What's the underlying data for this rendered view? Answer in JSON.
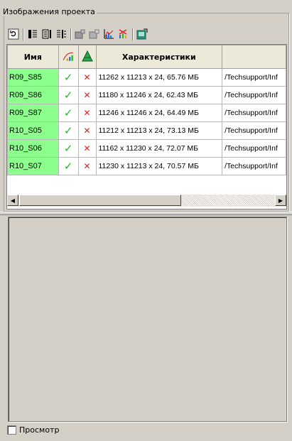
{
  "group": {
    "title": "Изображения проекта"
  },
  "toolbar": {
    "buttons": [
      "refresh-icon",
      "columns-left-icon",
      "columns-center-icon",
      "columns-right-icon",
      "image-add-icon",
      "image-remove-icon",
      "histogram-icon",
      "histogram-remove-icon",
      "export-icon"
    ]
  },
  "table": {
    "headers": {
      "name": "Имя",
      "characteristics": "Характеристики"
    },
    "rows": [
      {
        "name": "R09_S85",
        "characteristics": "11262 x 11213 x 24, 65.76 МБ",
        "path": "/Techsupport/Inf"
      },
      {
        "name": "R09_S86",
        "characteristics": "11180 x 11246 x 24, 62.43 МБ",
        "path": "/Techsupport/Inf"
      },
      {
        "name": "R09_S87",
        "characteristics": "11246 x 11246 x 24, 64.49 МБ",
        "path": "/Techsupport/Inf"
      },
      {
        "name": "R10_S05",
        "characteristics": "11212 x 11213 x 24, 73.13 МБ",
        "path": "/Techsupport/Inf"
      },
      {
        "name": "R10_S06",
        "characteristics": "11162 x 11230 x 24, 72.07 МБ",
        "path": "/Techsupport/Inf"
      },
      {
        "name": "R10_S07",
        "characteristics": "11230 x 11213 x 24, 70.57 МБ",
        "path": "/Techsupport/Inf"
      }
    ],
    "check_glyph": "✓",
    "cross_glyph": "✕"
  },
  "preview_checkbox": {
    "label": "Просмотр",
    "checked": false
  },
  "colors": {
    "name_cell": "#8cff8c",
    "check": "#22b822",
    "cross": "#e02020"
  }
}
